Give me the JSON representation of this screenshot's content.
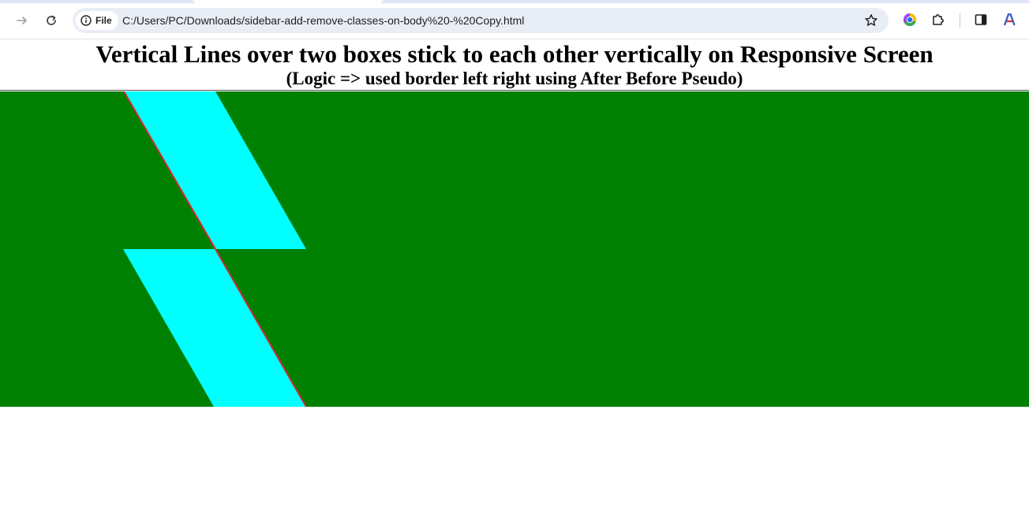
{
  "browser": {
    "site_chip_label": "File",
    "url": "C:/Users/PC/Downloads/sidebar-add-remove-classes-on-body%20-%20Copy.html",
    "icons": [
      "forward-arrow-icon",
      "reload-icon",
      "info-icon",
      "star-icon",
      "chrome-profile-icon",
      "extensions-icon",
      "side-panel-icon",
      "font-a-icon"
    ]
  },
  "page": {
    "title": "Vertical Lines over two boxes stick to each other vertically on Responsive Screen",
    "subtitle": "(Logic => used border left right using After Before Pseudo)"
  },
  "colors": {
    "box_background": "#008000",
    "stripe": "#00ffff",
    "edge_line": "#d22a2a"
  }
}
